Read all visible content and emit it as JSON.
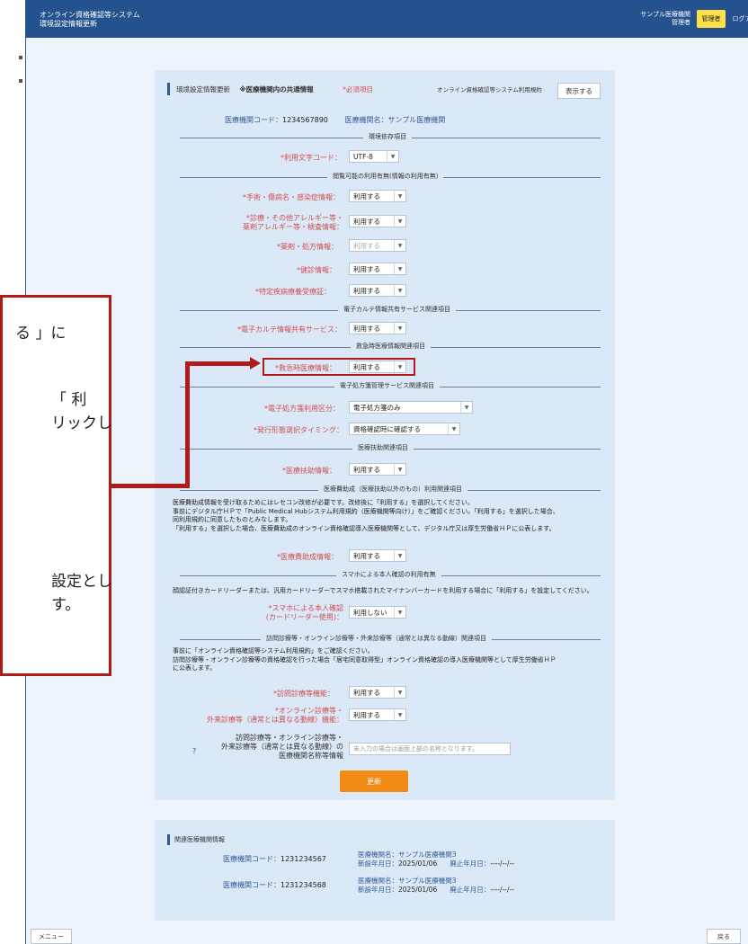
{
  "window": {
    "title_line1": "オンライン資格確認等システム",
    "title_line2": "環境設定情報更新",
    "user_line1": "サンプル医療機関",
    "user_line2": "管理者",
    "role_badge": "管理者",
    "logout": "ログアウト"
  },
  "form": {
    "heading": "環境設定情報更新",
    "heading_note": "※医療機関内の共通情報",
    "required_note": "*必須項目",
    "terms_label": "オンライン資格確認等システム利用規約",
    "terms_button": "表示する",
    "org_code_label": "医療機関コード：",
    "org_code": "1234567890",
    "org_name_label": "医療機関名：",
    "org_name": "サンプル医療機関",
    "sections": {
      "env": "環境依存項目",
      "browse": "閲覧可能の利用有無(情報の利用有無)",
      "ehr": "電子カルテ情報共有サービス関連項目",
      "emergency": "救急時医療情報関連項目",
      "eprescription": "電子処方箋管理サービス関連項目",
      "medical_aid": "医療扶助関連項目",
      "subsidy": "医療費助成（医療扶助以外のもの）利用関連項目",
      "smartphone": "スマホによる本人確認の利用有無",
      "visit": "訪問診療等・オンライン診療等・外来診療等（通常とは異なる動線）関連項目"
    },
    "fields": {
      "charset_label": "*利用文字コード：",
      "charset_value": "UTF-8",
      "surgery_label": "*手術・傷病名・感染症情報：",
      "surgery_value": "利用する",
      "diagnosis_label1": "*診療・その他アレルギー等・",
      "diagnosis_label2": "薬剤アレルギー等・検査情報：",
      "diagnosis_value": "利用する",
      "medication_label": "*薬剤・処方情報：",
      "medication_value": "利用する",
      "checkup_label": "*健診情報：",
      "checkup_value": "利用する",
      "specific_label": "*特定疾病療養受療証：",
      "specific_value": "利用する",
      "ehr_label": "*電子カルテ情報共有サービス：",
      "ehr_value": "利用する",
      "emergency_label": "*救急時医療情報：",
      "emergency_value": "利用する",
      "eprescription_type_label": "*電子処方箋利用区分：",
      "eprescription_type_value": "電子処方箋のみ",
      "issue_timing_label": "*発行形態選択タイミング：",
      "issue_timing_value": "資格確認時に確認する",
      "medical_aid_label": "*医療扶助情報：",
      "medical_aid_value": "利用する",
      "subsidy_label": "*医療費助成情報：",
      "subsidy_value": "利用する",
      "smartphone_label1": "*スマホによる本人確認",
      "smartphone_label2": "(カードリーダー使用)：",
      "smartphone_value": "利用しない",
      "visit_label": "*訪問診療等機能：",
      "visit_value": "利用する",
      "online_label1": "*オンライン診療等・",
      "online_label2": "外来診療等（通常とは異なる動線）機能：",
      "online_value": "利用する",
      "name_label1": "訪問診療等・オンライン診療等・",
      "name_label2": "外来診療等（通常とは異なる動線）の",
      "name_label3": "医療機関名称等情報",
      "name_placeholder": "未入力の場合は画面上部の名称となります。",
      "help_mark": "?"
    },
    "subsidy_text": [
      "医療費助成情報を受け取るためにはレセコン改修が必要です。改修後に「利用する」を選択してください。",
      "事前にデジタル庁ＨＰで「Public Medical Hubシステム利用規約（医療機関等向け）」をご確認ください。「利用する」を選択した場合、",
      "同利用規約に同意したものとみなします。",
      "「利用する」を選択した場合、医療費助成のオンライン資格確認導入医療機関等として、デジタル庁又は厚生労働省ＨＰに公表します。"
    ],
    "smartphone_text": "顔認証付きカードリーダーまたは、汎用カードリーダーでスマホ搭載されたマイナンバーカードを利用する場合に「利用する」を設定してください。",
    "visit_text": [
      "事前に「オンライン資格確認等システム利用規約」をご確認ください。",
      "訪問診療等・オンライン診療等の資格確認を行った場合「居宅同意取得型」オンライン資格確認の導入医療機関等として厚生労働省ＨＰ",
      "に公表します。"
    ],
    "update_button": "更新"
  },
  "related": {
    "heading": "関連医療機関情報",
    "rows": [
      {
        "code_label": "医療機関コード：",
        "code": "1231234567",
        "name_label": "医療機関名：",
        "name": "サンプル医療機関3",
        "start_label": "新設年月日：",
        "start": "2025/01/06",
        "end_label": "廃止年月日：",
        "end": "----/--/--"
      },
      {
        "code_label": "医療機関コード：",
        "code": "1231234568",
        "name_label": "医療機関名：",
        "name": "サンプル医療機関3",
        "start_label": "新設年月日：",
        "start": "2025/01/06",
        "end_label": "廃止年月日：",
        "end": "----/--/--"
      }
    ]
  },
  "footer": {
    "menu_button": "メニュー",
    "back_button": "戻る"
  },
  "callout": {
    "line1": "る 」に",
    "line2": "「 利",
    "line3": "リックし",
    "line4": "設定とし",
    "line5": "す。"
  },
  "colors": {
    "topbar": "#24528f",
    "card": "#dbe8f7",
    "accent_orange": "#f28a16",
    "badge_yellow": "#ffe04a",
    "callout_red": "#b01a1a"
  }
}
